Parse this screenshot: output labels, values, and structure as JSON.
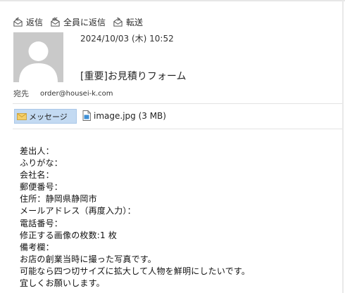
{
  "toolbar": {
    "reply_label": "返信",
    "reply_all_label": "全員に返信",
    "forward_label": "転送"
  },
  "message": {
    "date": "2024/10/03 (木) 10:52",
    "subject": "[重要]お見積りフォーム",
    "to_label": "宛先",
    "to_address": "order@housei-k.com"
  },
  "attachments": {
    "message_label": "メッセージ",
    "file_name": "image.jpg (3 MB)"
  },
  "body": {
    "lines": [
      "差出人：",
      "ふりがな：",
      "会社名：",
      "郵便番号：",
      "住所：静岡県静岡市",
      "メールアドレス（再度入力）：",
      "電話番号：",
      "修正する画像の枚数:1 枚",
      "備考欄：",
      "お店の創業当時に撮った写真です。",
      "可能なら四つ切サイズに拡大して人物を鮮明にしたいです。",
      "宜しくお願いします。"
    ]
  },
  "colors": {
    "accent": "#c3daf2",
    "avatar_bg": "#c9c9c9"
  }
}
